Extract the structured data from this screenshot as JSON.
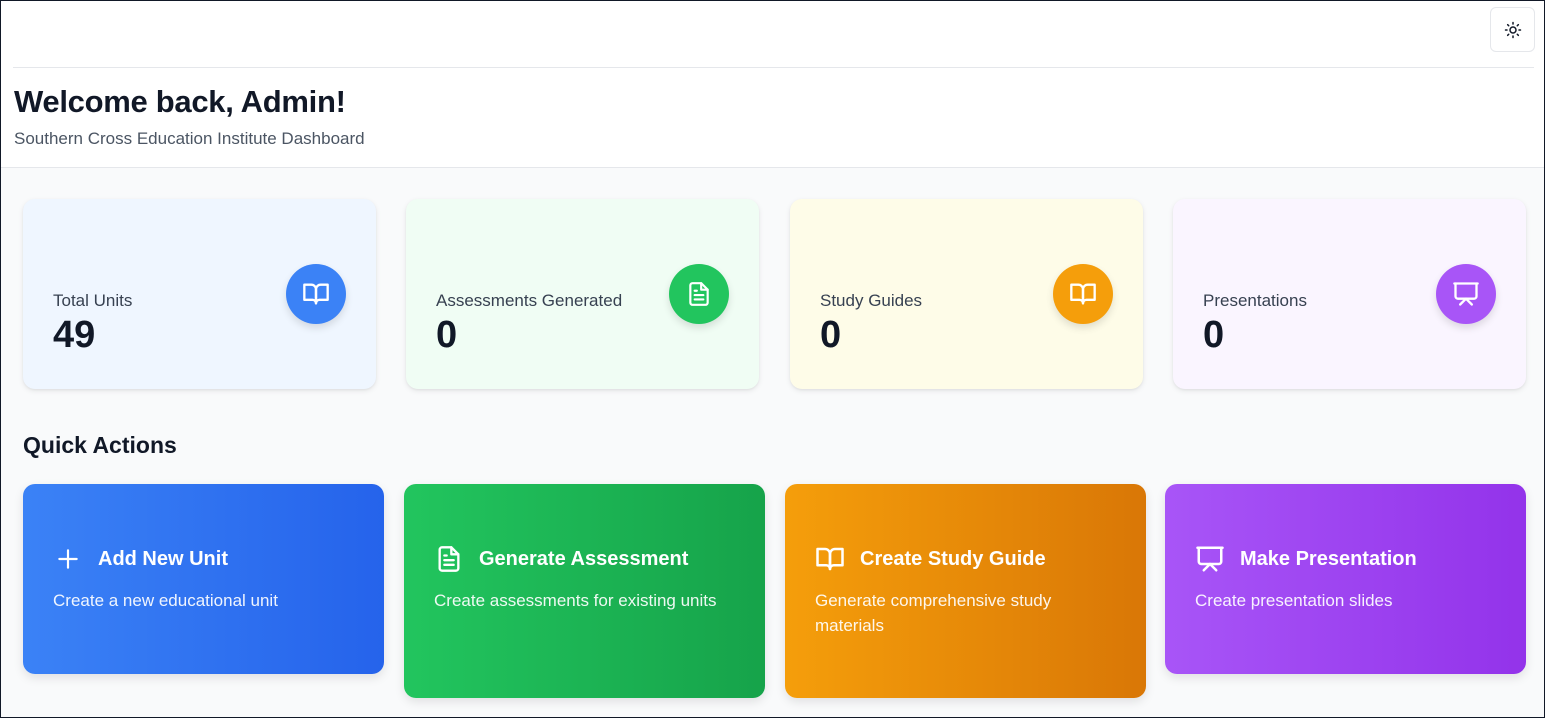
{
  "header": {
    "title": "Welcome back, Admin!",
    "subtitle": "Southern Cross Education Institute Dashboard"
  },
  "topbar": {
    "theme_toggle_icon": "sun-icon"
  },
  "stats": [
    {
      "label": "Total Units",
      "value": "49",
      "icon": "book-open-icon",
      "color": "#3b82f6",
      "bg": "#eff6ff"
    },
    {
      "label": "Assessments Generated",
      "value": "0",
      "icon": "file-text-icon",
      "color": "#22c55e",
      "bg": "#f0fdf4"
    },
    {
      "label": "Study Guides",
      "value": "0",
      "icon": "book-open-icon",
      "color": "#f59e0b",
      "bg": "#fefce8"
    },
    {
      "label": "Presentations",
      "value": "0",
      "icon": "presentation-icon",
      "color": "#a855f7",
      "bg": "#faf5ff"
    }
  ],
  "quick_actions": {
    "title": "Quick Actions",
    "items": [
      {
        "title": "Add New Unit",
        "description": "Create a new educational unit",
        "icon": "plus-icon",
        "gradient": [
          "#3b82f6",
          "#2563eb"
        ]
      },
      {
        "title": "Generate Assessment",
        "description": "Create assessments for existing units",
        "icon": "file-text-icon",
        "gradient": [
          "#22c55e",
          "#16a34a"
        ]
      },
      {
        "title": "Create Study Guide",
        "description": "Generate comprehensive study materials",
        "icon": "book-open-icon",
        "gradient": [
          "#f59e0b",
          "#d97706"
        ]
      },
      {
        "title": "Make Presentation",
        "description": "Create presentation slides",
        "icon": "presentation-icon",
        "gradient": [
          "#a855f7",
          "#9333ea"
        ]
      }
    ]
  }
}
